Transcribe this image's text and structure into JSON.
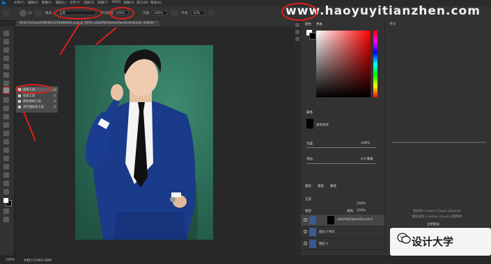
{
  "app": {
    "logo_text": "Ps"
  },
  "menu": [
    "文件(F)",
    "编辑(E)",
    "图像(I)",
    "图层(L)",
    "文字(Y)",
    "选择(S)",
    "滤镜(T)",
    "3D(D)",
    "视图(V)",
    "窗口(W)",
    "帮助(H)"
  ],
  "options": {
    "mode_label": "模式:",
    "mode_value": "正常",
    "opacity_label": "不透明度:",
    "opacity_value": "100%",
    "flow_label": "流量:",
    "flow_value": "100%",
    "smooth_label": "平滑:",
    "smooth_value": "10%",
    "brush_size": "13"
  },
  "watermark_url": "www.haoyuyitianzhen.com",
  "document_tab": "934a7e23aad1f0838212183846fdc.png @ 100% (a0b2f9b5bbfad5bcd3c0c0a1d6, RGB/8) *",
  "flyout": {
    "items": [
      {
        "label": "画笔工具",
        "key": "B"
      },
      {
        "label": "铅笔工具",
        "key": "B"
      },
      {
        "label": "颜色替换工具",
        "key": "B"
      },
      {
        "label": "混合器画笔工具",
        "key": "B"
      }
    ]
  },
  "panels": {
    "color_tabs": [
      "颜色",
      "色板"
    ],
    "props_tabs": [
      "属性"
    ],
    "props_label": "蒙版像素",
    "density_label": "浓度:",
    "density_value": "100%",
    "feather_label": "羽化:",
    "feather_value": "0.0 像素",
    "layer_tabs": [
      "图层",
      "通道",
      "路径"
    ],
    "blend_mode": "正常",
    "layer_opacity": "100%",
    "lock_label": "锁定:",
    "fill_label": "填充:",
    "fill_value": "100%",
    "layers": [
      "a0b2f9b5bbfad5bcd3c0",
      "图层 0 拷贝",
      "图层 0"
    ],
    "far_tab": "学习"
  },
  "far_panel_text": {
    "line1": "登录到 Creative Cloud Libraries",
    "line2": "请登录到 Creative Cloud 以使用库",
    "button": "立即登录"
  },
  "status": {
    "zoom": "100%",
    "doc": "文档:1.51M/1.68M"
  },
  "brand": "设计大学",
  "colors": {
    "accent_red": "#e0201b",
    "ui_dark": "#323232",
    "photo_bg": "#2d6a55",
    "suit": "#1a3a8a"
  }
}
